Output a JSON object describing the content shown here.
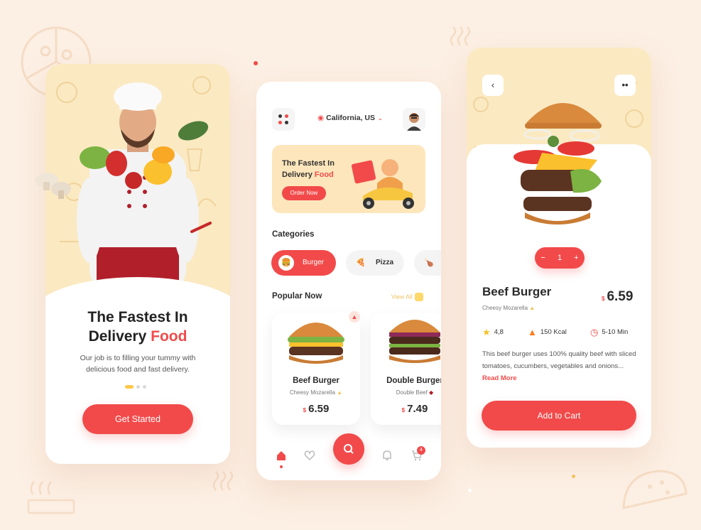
{
  "colors": {
    "accent": "#f24a4a",
    "background": "#fcefe3",
    "hero": "#fbe9c2",
    "yellow": "#ffc84a"
  },
  "onboarding": {
    "title_line1": "The Fastest In",
    "title_line2": "Delivery ",
    "title_accent": "Food",
    "description": "Our job is to filling your tummy with delicious food and fast delivery.",
    "cta": "Get Started"
  },
  "home": {
    "location": "California, US",
    "banner": {
      "line1": "The Fastest In",
      "line2": "Delivery ",
      "accent": "Food",
      "button": "Order Now"
    },
    "categories_title": "Categories",
    "categories": [
      {
        "label": "Burger",
        "icon": "burger-icon",
        "active": true
      },
      {
        "label": "Pizza",
        "icon": "pizza-icon",
        "active": false
      },
      {
        "label": "",
        "icon": "chicken-icon",
        "active": false
      }
    ],
    "popular_title": "Popular Now",
    "view_all": "View All",
    "products": [
      {
        "name": "Beef Burger",
        "sub": "Cheesy Mozarella",
        "currency": "$",
        "price": "6.59"
      },
      {
        "name": "Double Burger",
        "sub": "Double Beef",
        "currency": "$",
        "price": "7.49"
      }
    ],
    "cart_count": "4",
    "nav_icons": [
      "home-icon",
      "heart-icon",
      "search-icon",
      "bell-icon",
      "cart-icon"
    ]
  },
  "detail": {
    "quantity": "1",
    "minus": "−",
    "plus": "+",
    "name": "Beef Burger",
    "sub": "Cheesy Mozarella",
    "currency": "$",
    "price": "6.59",
    "rating": "4,8",
    "calories": "150 Kcal",
    "time": "5-10 Min",
    "description": "This beef burger uses 100% quality beef with sliced tomatoes, cucumbers, vegetables and onions...",
    "read_more": "Read More",
    "cta": "Add to Cart"
  }
}
